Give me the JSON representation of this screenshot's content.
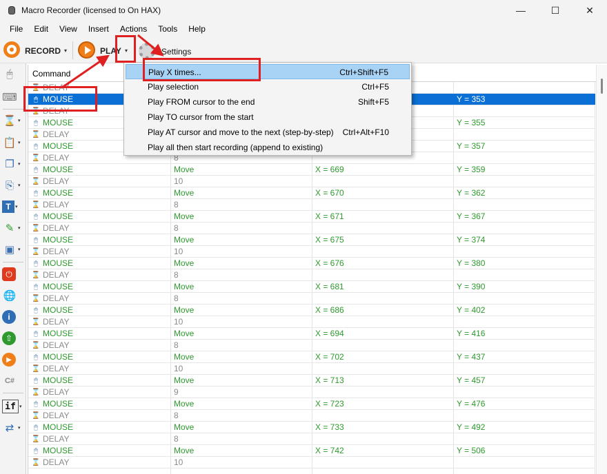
{
  "window": {
    "title": "Macro Recorder (licensed to On HAX)",
    "minimize": "—",
    "maximize": "☐",
    "close": "✕"
  },
  "menu": [
    "File",
    "Edit",
    "View",
    "Insert",
    "Actions",
    "Tools",
    "Help"
  ],
  "toolbar": {
    "record_label": "RECORD",
    "play_label": "PLAY",
    "settings_label": "Settings",
    "dropdown_arrow": "▾"
  },
  "grid": {
    "column_header": "Command",
    "rows": [
      {
        "cmd": "DELAY",
        "p1": "",
        "p2": "",
        "p3": ""
      },
      {
        "cmd": "MOUSE",
        "p1": "",
        "p2": "",
        "p3": "Y = 353",
        "selected": true
      },
      {
        "cmd": "DELAY",
        "p1": "",
        "p2": "",
        "p3": ""
      },
      {
        "cmd": "MOUSE",
        "p1": "",
        "p2": "",
        "p3": "Y = 355"
      },
      {
        "cmd": "DELAY",
        "p1": "",
        "p2": "",
        "p3": ""
      },
      {
        "cmd": "MOUSE",
        "p1": "",
        "p2": "",
        "p3": "Y = 357"
      },
      {
        "cmd": "DELAY",
        "p1": "8",
        "p2": "",
        "p3": ""
      },
      {
        "cmd": "MOUSE",
        "p1": "Move",
        "p2": "X = 669",
        "p3": "Y = 359"
      },
      {
        "cmd": "DELAY",
        "p1": "10",
        "p2": "",
        "p3": ""
      },
      {
        "cmd": "MOUSE",
        "p1": "Move",
        "p2": "X = 670",
        "p3": "Y = 362"
      },
      {
        "cmd": "DELAY",
        "p1": "8",
        "p2": "",
        "p3": ""
      },
      {
        "cmd": "MOUSE",
        "p1": "Move",
        "p2": "X = 671",
        "p3": "Y = 367"
      },
      {
        "cmd": "DELAY",
        "p1": "8",
        "p2": "",
        "p3": ""
      },
      {
        "cmd": "MOUSE",
        "p1": "Move",
        "p2": "X = 675",
        "p3": "Y = 374"
      },
      {
        "cmd": "DELAY",
        "p1": "10",
        "p2": "",
        "p3": ""
      },
      {
        "cmd": "MOUSE",
        "p1": "Move",
        "p2": "X = 676",
        "p3": "Y = 380"
      },
      {
        "cmd": "DELAY",
        "p1": "8",
        "p2": "",
        "p3": ""
      },
      {
        "cmd": "MOUSE",
        "p1": "Move",
        "p2": "X = 681",
        "p3": "Y = 390"
      },
      {
        "cmd": "DELAY",
        "p1": "8",
        "p2": "",
        "p3": ""
      },
      {
        "cmd": "MOUSE",
        "p1": "Move",
        "p2": "X = 686",
        "p3": "Y = 402"
      },
      {
        "cmd": "DELAY",
        "p1": "10",
        "p2": "",
        "p3": ""
      },
      {
        "cmd": "MOUSE",
        "p1": "Move",
        "p2": "X = 694",
        "p3": "Y = 416"
      },
      {
        "cmd": "DELAY",
        "p1": "8",
        "p2": "",
        "p3": ""
      },
      {
        "cmd": "MOUSE",
        "p1": "Move",
        "p2": "X = 702",
        "p3": "Y = 437"
      },
      {
        "cmd": "DELAY",
        "p1": "10",
        "p2": "",
        "p3": ""
      },
      {
        "cmd": "MOUSE",
        "p1": "Move",
        "p2": "X = 713",
        "p3": "Y = 457"
      },
      {
        "cmd": "DELAY",
        "p1": "9",
        "p2": "",
        "p3": ""
      },
      {
        "cmd": "MOUSE",
        "p1": "Move",
        "p2": "X = 723",
        "p3": "Y = 476"
      },
      {
        "cmd": "DELAY",
        "p1": "8",
        "p2": "",
        "p3": ""
      },
      {
        "cmd": "MOUSE",
        "p1": "Move",
        "p2": "X = 733",
        "p3": "Y = 492"
      },
      {
        "cmd": "DELAY",
        "p1": "8",
        "p2": "",
        "p3": ""
      },
      {
        "cmd": "MOUSE",
        "p1": "Move",
        "p2": "X = 742",
        "p3": "Y = 506"
      },
      {
        "cmd": "DELAY",
        "p1": "10",
        "p2": "",
        "p3": ""
      }
    ]
  },
  "play_menu": [
    {
      "label": "Play X times...",
      "shortcut": "Ctrl+Shift+F5",
      "highlighted": true
    },
    {
      "label": "Play selection",
      "shortcut": "Ctrl+F5"
    },
    {
      "label": "Play FROM cursor to the end",
      "shortcut": "Shift+F5"
    },
    {
      "label": "Play TO cursor from the start",
      "shortcut": ""
    },
    {
      "label": "Play AT cursor and move to the next (step-by-step)",
      "shortcut": "Ctrl+Alt+F10"
    },
    {
      "label": "Play all then start recording (append to existing)",
      "shortcut": ""
    }
  ],
  "sidebar_icons": [
    "mouse-icon",
    "keyboard-icon",
    "hourglass-icon",
    "clipboard-icon",
    "window-icon",
    "copy-icon",
    "text-icon",
    "eyedropper-icon",
    "image-icon",
    "stop-icon",
    "globe-icon",
    "info-icon",
    "web-icon",
    "play-icon",
    "csharp-icon",
    "if-icon",
    "loop-icon"
  ],
  "colors": {
    "selection": "#0a70d6",
    "menu_highlight": "#a9d3f5",
    "mouse_text": "#2e9a2e",
    "delay_text": "#8a8a8a",
    "annotation": "#e02020",
    "accent_orange": "#f07f1a"
  }
}
